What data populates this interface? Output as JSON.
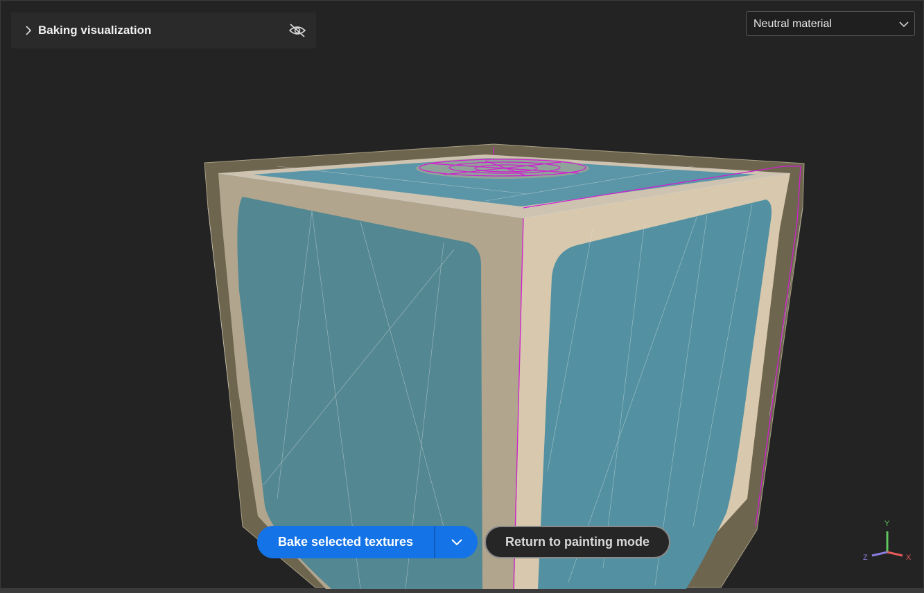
{
  "viz_panel": {
    "title": "Baking visualization",
    "expand_icon": "chevron-right-icon",
    "visibility_icon": "eye-off-icon"
  },
  "material_dropdown": {
    "selected": "Neutral material",
    "icon": "chevron-down-icon"
  },
  "actions": {
    "bake_label": "Bake selected textures",
    "bake_menu_icon": "chevron-down-icon",
    "return_label": "Return to painting mode"
  },
  "axis_gizmo": {
    "y_label": "Y",
    "x_label": "X",
    "z_label": "Z"
  },
  "colors": {
    "accent": "#1473e6",
    "viewport_bg": "#232323",
    "mesh_face": "#52899b",
    "mesh_frame": "#d8c8ad",
    "cage": "#6e654f",
    "selection": "#d020d0"
  }
}
